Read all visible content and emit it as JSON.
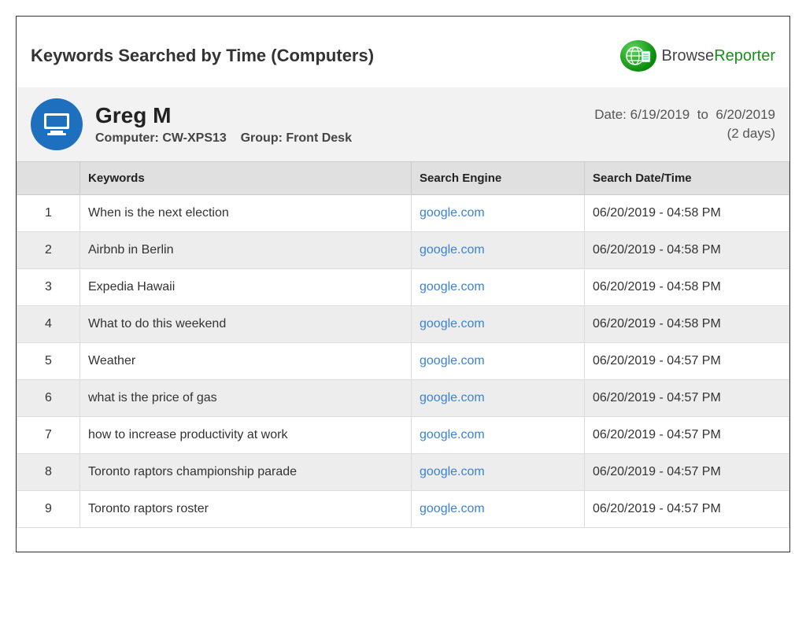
{
  "report": {
    "title": "Keywords Searched by Time (Computers)"
  },
  "brand": {
    "name1": "Browse",
    "name2": "Reporter"
  },
  "user": {
    "name": "Greg M",
    "computer_label": "Computer:",
    "computer_value": "CW-XPS13",
    "group_label": "Group:",
    "group_value": "Front Desk"
  },
  "date_range": {
    "prefix": "Date:",
    "from": "6/19/2019",
    "sep": "to",
    "to": "6/20/2019",
    "duration": "(2 days)"
  },
  "columns": {
    "num": "",
    "keywords": "Keywords",
    "search_engine": "Search Engine",
    "search_datetime": "Search Date/Time"
  },
  "rows": [
    {
      "n": "1",
      "kw": "When is the next election",
      "se": "google.com",
      "dt": "06/20/2019 - 04:58 PM"
    },
    {
      "n": "2",
      "kw": "Airbnb in Berlin",
      "se": "google.com",
      "dt": "06/20/2019 - 04:58 PM"
    },
    {
      "n": "3",
      "kw": "Expedia Hawaii",
      "se": "google.com",
      "dt": "06/20/2019 - 04:58 PM"
    },
    {
      "n": "4",
      "kw": "What to do this weekend",
      "se": "google.com",
      "dt": "06/20/2019 - 04:58 PM"
    },
    {
      "n": "5",
      "kw": "Weather",
      "se": "google.com",
      "dt": "06/20/2019 - 04:57 PM"
    },
    {
      "n": "6",
      "kw": "what is the price of gas",
      "se": "google.com",
      "dt": "06/20/2019 - 04:57 PM"
    },
    {
      "n": "7",
      "kw": "how to increase productivity at work",
      "se": "google.com",
      "dt": "06/20/2019 - 04:57 PM"
    },
    {
      "n": "8",
      "kw": "Toronto raptors championship parade",
      "se": "google.com",
      "dt": "06/20/2019 - 04:57 PM"
    },
    {
      "n": "9",
      "kw": "Toronto raptors roster",
      "se": "google.com",
      "dt": "06/20/2019 - 04:57 PM"
    }
  ]
}
